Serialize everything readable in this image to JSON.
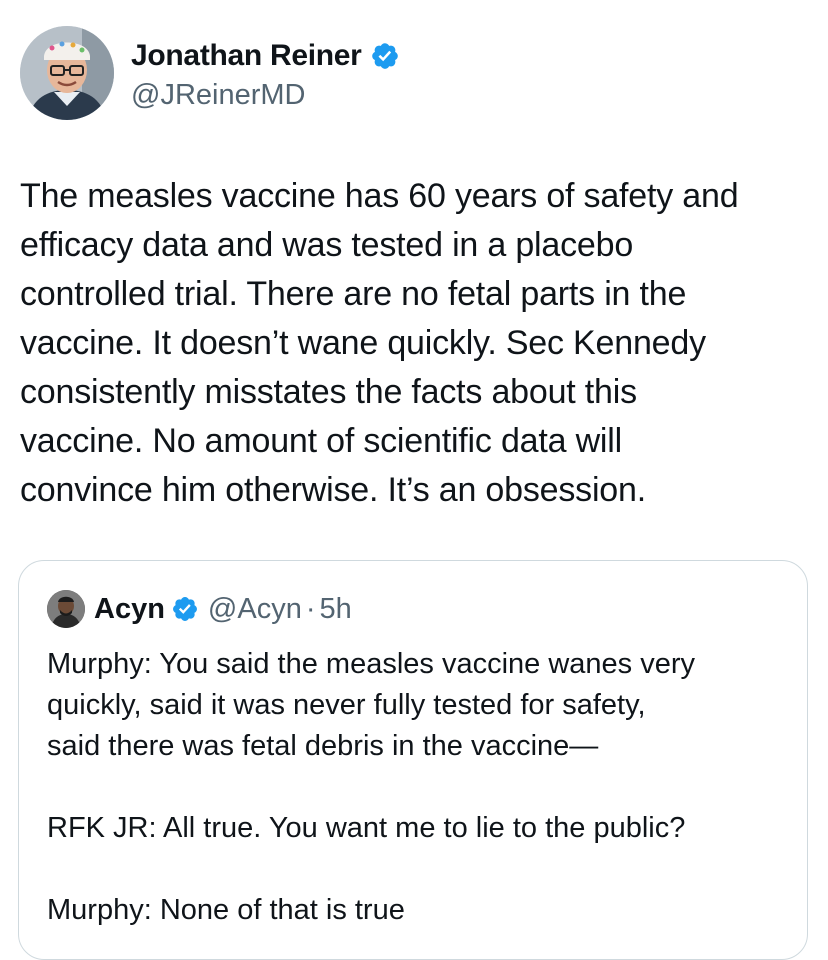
{
  "author": {
    "display_name": "Jonathan Reiner",
    "handle": "@JReinerMD",
    "verified_icon": "verified-badge-icon",
    "badge_color": "#1d9bf0"
  },
  "tweet": {
    "lines": [
      "The measles vaccine has 60 years of safety and",
      "efficacy data and was tested in a placebo",
      "controlled trial. There are no fetal parts in the",
      "vaccine. It doesn’t wane quickly. Sec Kennedy",
      "consistently misstates the facts about this",
      "vaccine. No amount of scientific data will",
      "convince him otherwise. It’s an obsession."
    ]
  },
  "quote": {
    "display_name": "Acyn",
    "handle": "@Acyn",
    "separator": "·",
    "time": "5h",
    "lines": [
      "Murphy: You said the measles vaccine wanes very",
      "quickly, said it was never fully tested for safety,",
      "said there was fetal debris in the vaccine—"
    ],
    "line_2": "RFK JR: All true. You want me to lie to the public?",
    "line_3": "Murphy: None of that is true"
  },
  "colors": {
    "text": "#0f1419",
    "secondary": "#536471",
    "border": "#cfd9de",
    "accent": "#1d9bf0"
  }
}
